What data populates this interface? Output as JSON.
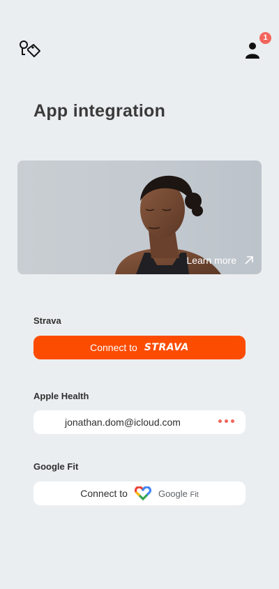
{
  "header": {
    "logo_icon": "tag-bag-icon",
    "profile_icon": "user-icon",
    "notification_count": "1"
  },
  "page": {
    "title": "App integration"
  },
  "hero": {
    "learn_more_label": "Learn more",
    "learn_more_icon": "arrow-up-right-icon"
  },
  "strava": {
    "label": "Strava",
    "button_text": "Connect to",
    "brand": "STRAVA",
    "button_color": "#fc4c02"
  },
  "apple_health": {
    "label": "Apple Health",
    "email": "jonathan.dom@icloud.com",
    "menu_icon": "more-dots-icon"
  },
  "google_fit": {
    "label": "Google Fit",
    "button_text": "Connect to",
    "brand_google": "Google",
    "brand_fit": "Fit",
    "logo_icon": "google-fit-heart-icon"
  },
  "colors": {
    "background": "#ebeef0",
    "accent": "#f2655d",
    "strava_orange": "#fc4c02"
  }
}
